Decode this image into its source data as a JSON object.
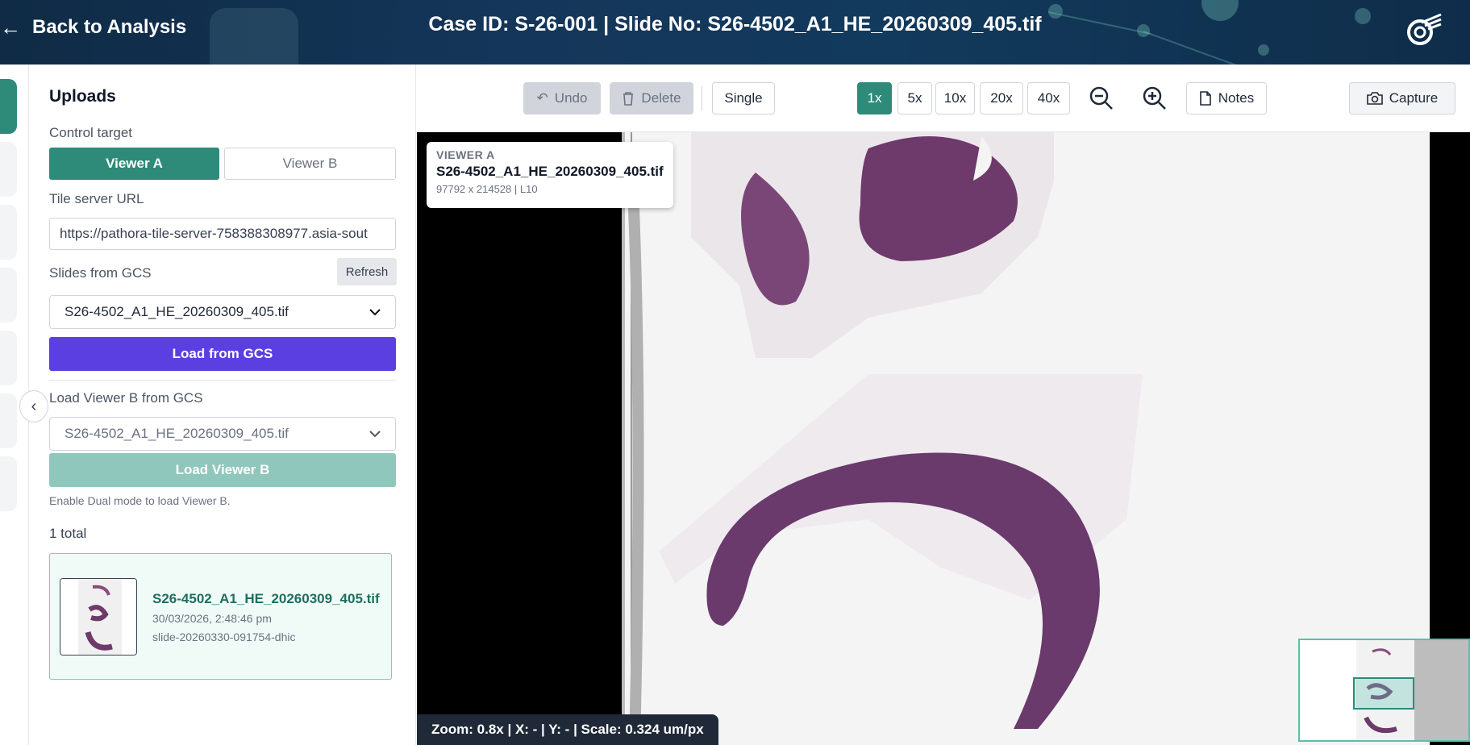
{
  "header": {
    "back_label": "Back to Analysis",
    "title": "Case ID: S-26-001 | Slide No: S26-4502_A1_HE_20260309_405.tif"
  },
  "panel": {
    "title": "Uploads",
    "control_target_label": "Control target",
    "viewer_a": "Viewer A",
    "viewer_b": "Viewer B",
    "tile_server_label": "Tile server URL",
    "tile_server_value": "https://pathora-tile-server-758388308977.asia-sout",
    "slides_label": "Slides from GCS",
    "refresh_label": "Refresh",
    "slide_select_value": "S26-4502_A1_HE_20260309_405.tif",
    "load_gcs_label": "Load from GCS",
    "viewer_b_label": "Load Viewer B from GCS",
    "viewer_b_select_value": "S26-4502_A1_HE_20260309_405.tif",
    "load_viewer_b_label": "Load Viewer B",
    "dual_hint": "Enable Dual mode to load Viewer B.",
    "total": "1 total",
    "upload": {
      "name": "S26-4502_A1_HE_20260309_405.tif",
      "date": "30/03/2026, 2:48:46 pm",
      "id": "slide-20260330-091754-dhic"
    }
  },
  "toolbar": {
    "undo": "Undo",
    "delete": "Delete",
    "single": "Single",
    "zoom_levels": [
      "1x",
      "5x",
      "10x",
      "20x",
      "40x"
    ],
    "active_zoom": "1x",
    "notes": "Notes",
    "capture": "Capture"
  },
  "viewer": {
    "label_title": "VIEWER A",
    "label_file": "S26-4502_A1_HE_20260309_405.tif",
    "label_meta": "97792 x 214528 | L10",
    "status": "Zoom: 0.8x | X: - | Y: - | Scale: 0.324 um/px"
  },
  "colors": {
    "accent": "#2e8b7a",
    "primary_button": "#5b3fe0",
    "disabled_button": "#8fc7bc"
  }
}
